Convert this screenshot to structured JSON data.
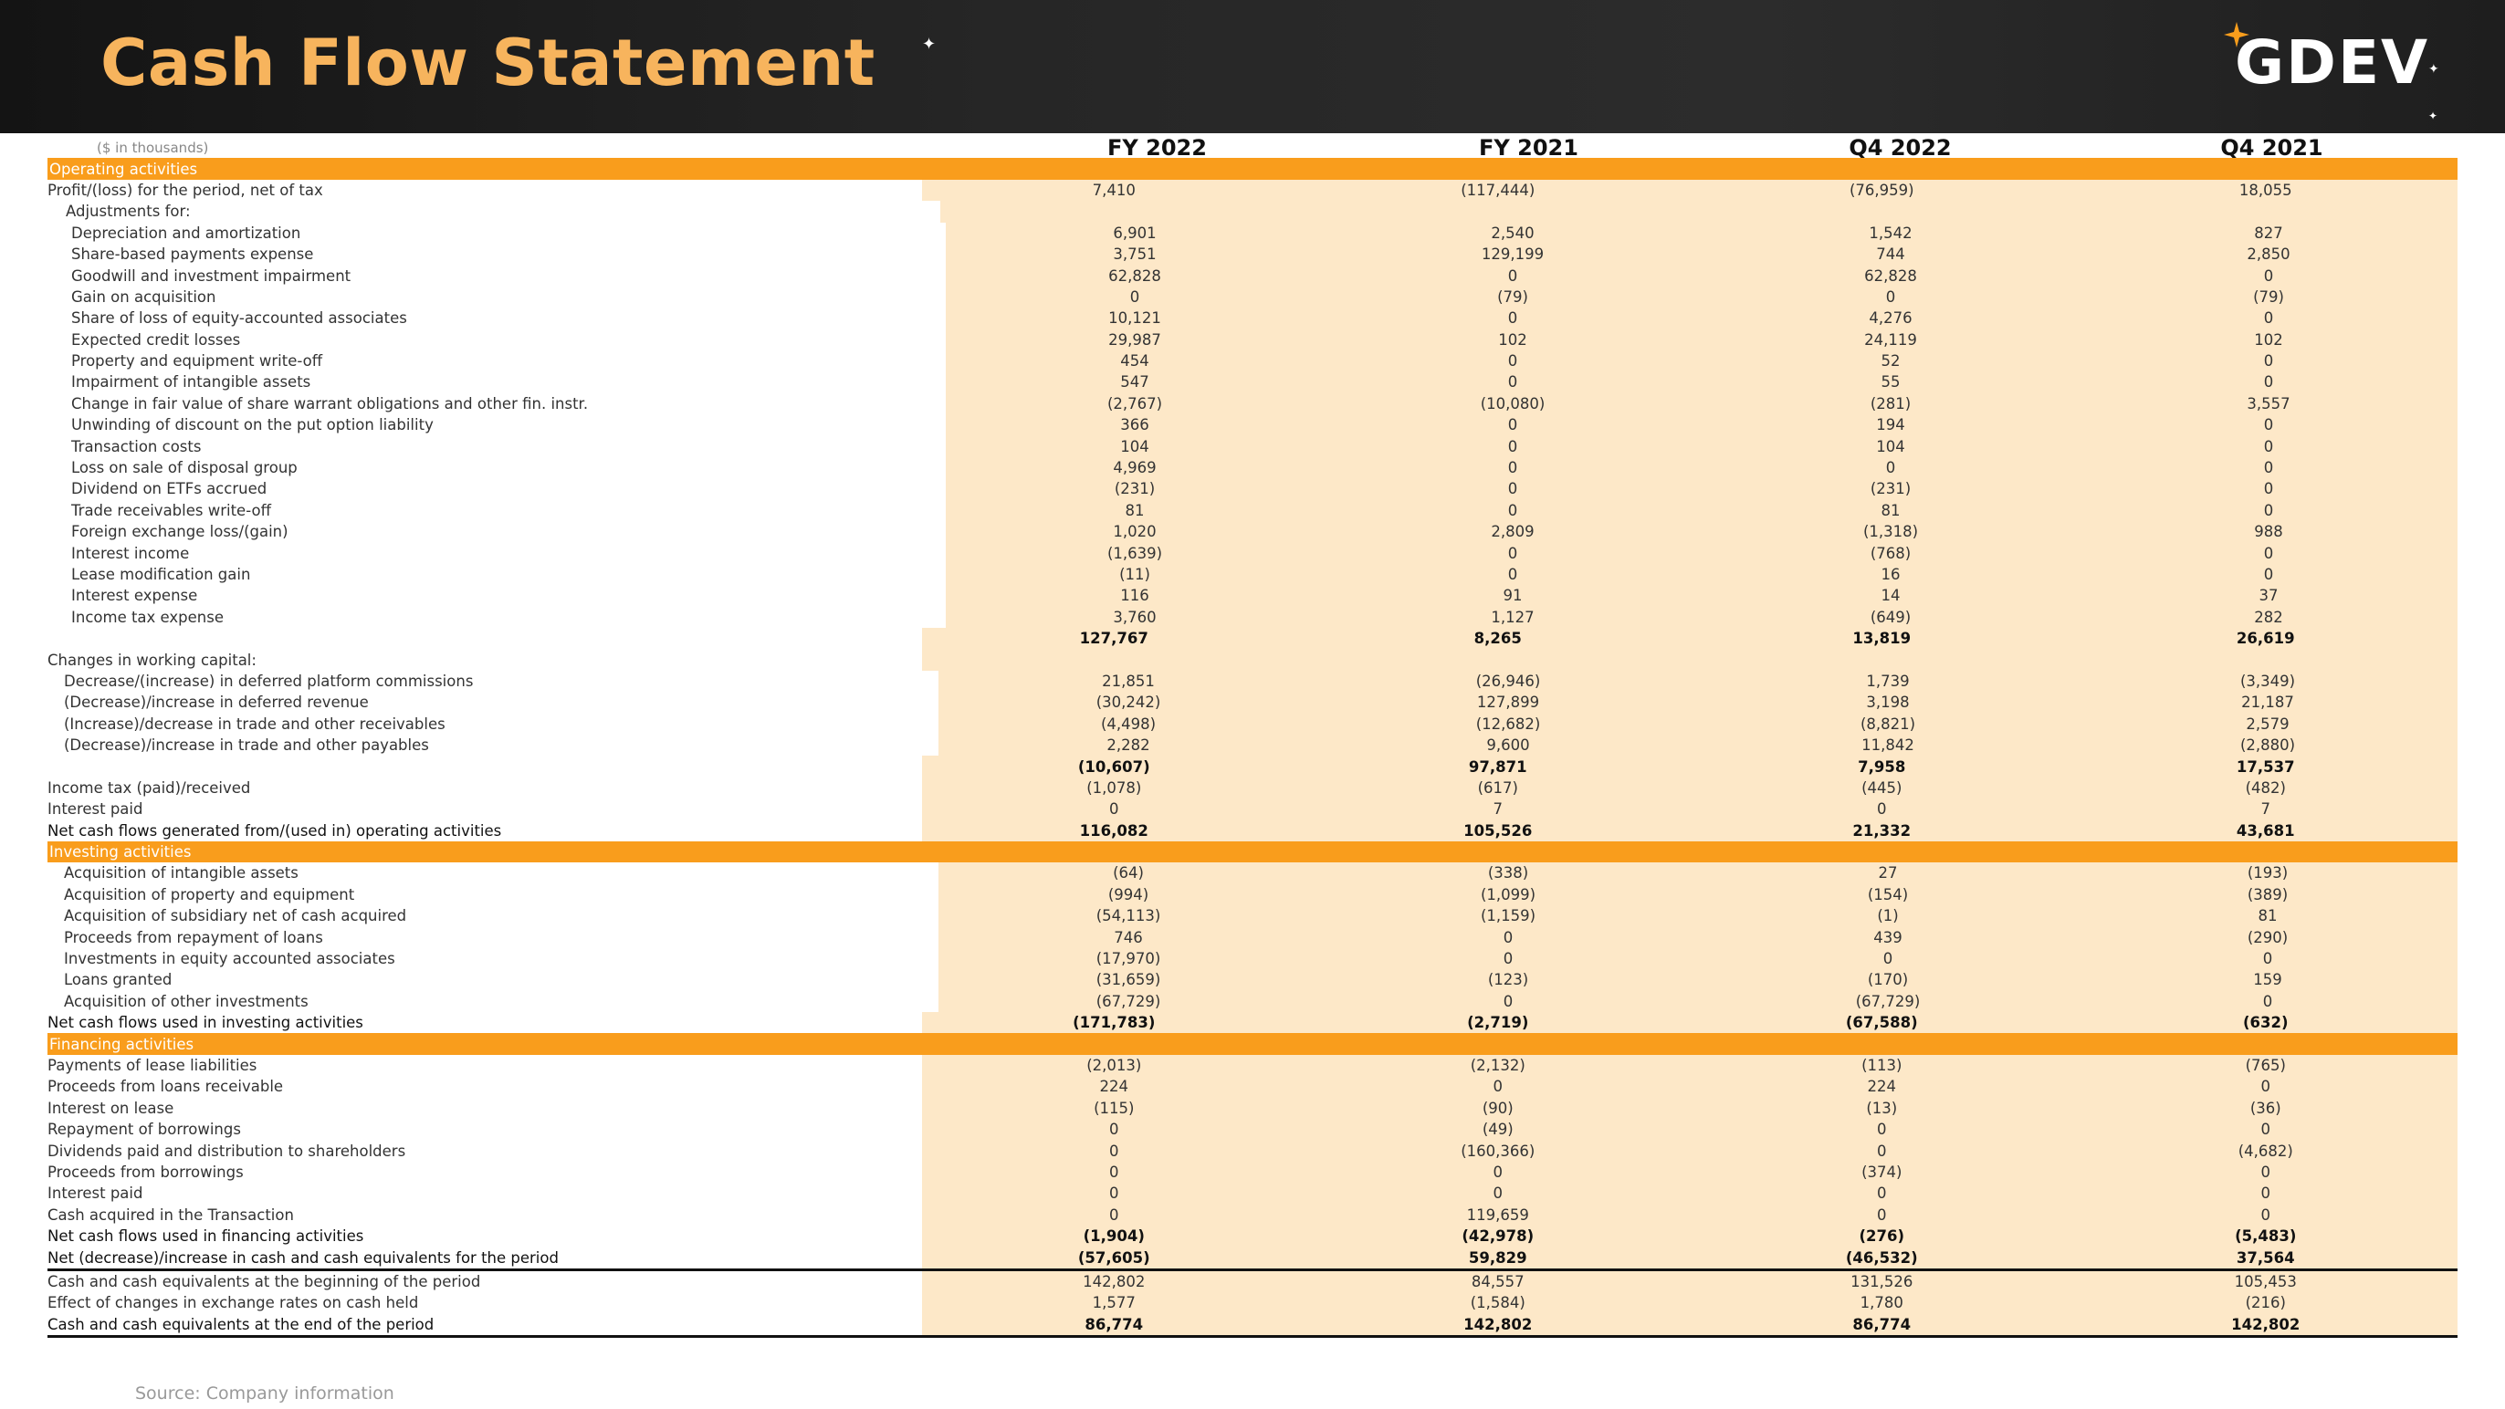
{
  "header": {
    "title": "Cash Flow Statement",
    "logo": "GDEV"
  },
  "table": {
    "unit_note": "($ in thousands)",
    "columns": [
      "FY 2022",
      "FY 2021",
      "Q4 2022",
      "Q4 2021"
    ],
    "rows": [
      {
        "type": "section",
        "label": "Operating activities"
      },
      {
        "type": "item",
        "indent": 0,
        "label": "Profit/(loss) for the period, net of tax",
        "values": [
          "7,410",
          "(117,444)",
          "(76,959)",
          "18,055"
        ]
      },
      {
        "type": "item",
        "indent": 1,
        "label": "Adjustments for:",
        "values": [
          "",
          "",
          "",
          ""
        ]
      },
      {
        "type": "item",
        "indent": 2,
        "label": "Depreciation and amortization",
        "values": [
          "6,901",
          "2,540",
          "1,542",
          "827"
        ]
      },
      {
        "type": "item",
        "indent": 2,
        "label": "Share-based payments expense",
        "values": [
          "3,751",
          "129,199",
          "744",
          "2,850"
        ]
      },
      {
        "type": "item",
        "indent": 2,
        "label": "Goodwill and investment impairment",
        "values": [
          "62,828",
          "0",
          "62,828",
          "0"
        ]
      },
      {
        "type": "item",
        "indent": 2,
        "label": "Gain on acquisition",
        "values": [
          "0",
          "(79)",
          "0",
          "(79)"
        ]
      },
      {
        "type": "item",
        "indent": 2,
        "label": "Share of loss of equity-accounted associates",
        "values": [
          "10,121",
          "0",
          "4,276",
          "0"
        ]
      },
      {
        "type": "item",
        "indent": 2,
        "label": "Expected credit losses",
        "values": [
          "29,987",
          "102",
          "24,119",
          "102"
        ]
      },
      {
        "type": "item",
        "indent": 2,
        "label": "Property and equipment write-off",
        "values": [
          "454",
          "0",
          "52",
          "0"
        ]
      },
      {
        "type": "item",
        "indent": 2,
        "label": "Impairment of intangible assets",
        "values": [
          "547",
          "0",
          "55",
          "0"
        ]
      },
      {
        "type": "item",
        "indent": 2,
        "label": "Change in fair value of share warrant obligations and other fin. instr.",
        "values": [
          "(2,767)",
          "(10,080)",
          "(281)",
          "3,557"
        ]
      },
      {
        "type": "item",
        "indent": 2,
        "label": "Unwinding of discount on the put option liability",
        "values": [
          "366",
          "0",
          "194",
          "0"
        ]
      },
      {
        "type": "item",
        "indent": 2,
        "label": "Transaction costs",
        "values": [
          "104",
          "0",
          "104",
          "0"
        ]
      },
      {
        "type": "item",
        "indent": 2,
        "label": "Loss on sale of disposal group",
        "values": [
          "4,969",
          "0",
          "0",
          "0"
        ]
      },
      {
        "type": "item",
        "indent": 2,
        "label": "Dividend on ETFs accrued",
        "values": [
          "(231)",
          "0",
          "(231)",
          "0"
        ]
      },
      {
        "type": "item",
        "indent": 2,
        "label": "Trade receivables write-off",
        "values": [
          "81",
          "0",
          "81",
          "0"
        ]
      },
      {
        "type": "item",
        "indent": 2,
        "label": "Foreign exchange loss/(gain)",
        "values": [
          "1,020",
          "2,809",
          "(1,318)",
          "988"
        ]
      },
      {
        "type": "item",
        "indent": 2,
        "label": "Interest income",
        "values": [
          "(1,639)",
          "0",
          "(768)",
          "0"
        ]
      },
      {
        "type": "item",
        "indent": 2,
        "label": "Lease modification gain",
        "values": [
          "(11)",
          "0",
          "16",
          "0"
        ]
      },
      {
        "type": "item",
        "indent": 2,
        "label": "Interest expense",
        "values": [
          "116",
          "91",
          "14",
          "37"
        ]
      },
      {
        "type": "item",
        "indent": 2,
        "label": "Income tax expense",
        "values": [
          "3,760",
          "1,127",
          "(649)",
          "282"
        ]
      },
      {
        "type": "subtotal",
        "label": "",
        "values": [
          "127,767",
          "8,265",
          "13,819",
          "26,619"
        ]
      },
      {
        "type": "item",
        "indent": 0,
        "label": "Changes in working capital:",
        "values": [
          "",
          "",
          "",
          ""
        ]
      },
      {
        "type": "item",
        "indent": 3,
        "label": "Decrease/(increase) in deferred platform commissions",
        "values": [
          "21,851",
          "(26,946)",
          "1,739",
          "(3,349)"
        ]
      },
      {
        "type": "item",
        "indent": 3,
        "label": "(Decrease)/increase in deferred revenue",
        "values": [
          "(30,242)",
          "127,899",
          "3,198",
          "21,187"
        ]
      },
      {
        "type": "item",
        "indent": 3,
        "label": "(Increase)/decrease in trade and other receivables",
        "values": [
          "(4,498)",
          "(12,682)",
          "(8,821)",
          "2,579"
        ]
      },
      {
        "type": "item",
        "indent": 3,
        "label": "(Decrease)/increase in trade and other payables",
        "values": [
          "2,282",
          "9,600",
          "11,842",
          "(2,880)"
        ]
      },
      {
        "type": "subtotal",
        "label": "",
        "values": [
          "(10,607)",
          "97,871",
          "7,958",
          "17,537"
        ]
      },
      {
        "type": "item",
        "indent": 0,
        "label": "Income tax (paid)/received",
        "values": [
          "(1,078)",
          "(617)",
          "(445)",
          "(482)"
        ]
      },
      {
        "type": "item",
        "indent": 0,
        "label": "Interest paid",
        "values": [
          "0",
          "7",
          "0",
          "7"
        ]
      },
      {
        "type": "total",
        "label": "Net cash flows generated from/(used in) operating activities",
        "values": [
          "116,082",
          "105,526",
          "21,332",
          "43,681"
        ]
      },
      {
        "type": "section",
        "label": "Investing activities"
      },
      {
        "type": "item",
        "indent": 3,
        "label": "Acquisition of intangible assets",
        "values": [
          "(64)",
          "(338)",
          "27",
          "(193)"
        ]
      },
      {
        "type": "item",
        "indent": 3,
        "label": "Acquisition of property and equipment",
        "values": [
          "(994)",
          "(1,099)",
          "(154)",
          "(389)"
        ]
      },
      {
        "type": "item",
        "indent": 3,
        "label": "Acquisition of subsidiary net of cash acquired",
        "values": [
          "(54,113)",
          "(1,159)",
          "(1)",
          "81"
        ]
      },
      {
        "type": "item",
        "indent": 3,
        "label": "Proceeds from repayment of loans",
        "values": [
          "746",
          "0",
          "439",
          "(290)"
        ]
      },
      {
        "type": "item",
        "indent": 3,
        "label": "Investments in equity accounted associates",
        "values": [
          "(17,970)",
          "0",
          "0",
          "0"
        ]
      },
      {
        "type": "item",
        "indent": 3,
        "label": "Loans granted",
        "values": [
          "(31,659)",
          "(123)",
          "(170)",
          "159"
        ]
      },
      {
        "type": "item",
        "indent": 3,
        "label": "Acquisition of other investments",
        "values": [
          "(67,729)",
          "0",
          "(67,729)",
          "0"
        ]
      },
      {
        "type": "total",
        "label": "Net cash flows used in investing activities",
        "values": [
          "(171,783)",
          "(2,719)",
          "(67,588)",
          "(632)"
        ]
      },
      {
        "type": "section",
        "label": "Financing activities"
      },
      {
        "type": "item",
        "indent": 0,
        "label": "Payments of lease liabilities",
        "values": [
          "(2,013)",
          "(2,132)",
          "(113)",
          "(765)"
        ]
      },
      {
        "type": "item",
        "indent": 0,
        "label": "Proceeds from loans receivable",
        "values": [
          "224",
          "0",
          "224",
          "0"
        ]
      },
      {
        "type": "item",
        "indent": 0,
        "label": "Interest on lease",
        "values": [
          "(115)",
          "(90)",
          "(13)",
          "(36)"
        ]
      },
      {
        "type": "item",
        "indent": 0,
        "label": "Repayment of borrowings",
        "values": [
          "0",
          "(49)",
          "0",
          "0"
        ]
      },
      {
        "type": "item",
        "indent": 0,
        "label": "Dividends paid and distribution to shareholders",
        "values": [
          "0",
          "(160,366)",
          "0",
          "(4,682)"
        ]
      },
      {
        "type": "item",
        "indent": 0,
        "label": "Proceeds from borrowings",
        "values": [
          "0",
          "0",
          "(374)",
          "0"
        ]
      },
      {
        "type": "item",
        "indent": 0,
        "label": "Interest paid",
        "values": [
          "0",
          "0",
          "0",
          "0"
        ]
      },
      {
        "type": "item",
        "indent": 0,
        "label": "Cash acquired in the Transaction",
        "values": [
          "0",
          "119,659",
          "0",
          "0"
        ]
      },
      {
        "type": "total",
        "label": "Net cash flows used in financing activities",
        "values": [
          "(1,904)",
          "(42,978)",
          "(276)",
          "(5,483)"
        ]
      },
      {
        "type": "total-underline",
        "label": "Net (decrease)/increase in cash and cash equivalents for the period",
        "values": [
          "(57,605)",
          "59,829",
          "(46,532)",
          "37,564"
        ]
      },
      {
        "type": "item",
        "indent": 0,
        "label": "Cash and cash equivalents at the beginning of the period",
        "values": [
          "142,802",
          "84,557",
          "131,526",
          "105,453"
        ]
      },
      {
        "type": "item",
        "indent": 0,
        "label": "Effect of changes in exchange rates on cash held",
        "values": [
          "1,577",
          "(1,584)",
          "1,780",
          "(216)"
        ]
      },
      {
        "type": "total-underline",
        "label": "Cash and cash equivalents at the end of the period",
        "values": [
          "86,774",
          "142,802",
          "86,774",
          "142,802"
        ]
      }
    ]
  },
  "footer": {
    "source": "Source: Company information"
  }
}
